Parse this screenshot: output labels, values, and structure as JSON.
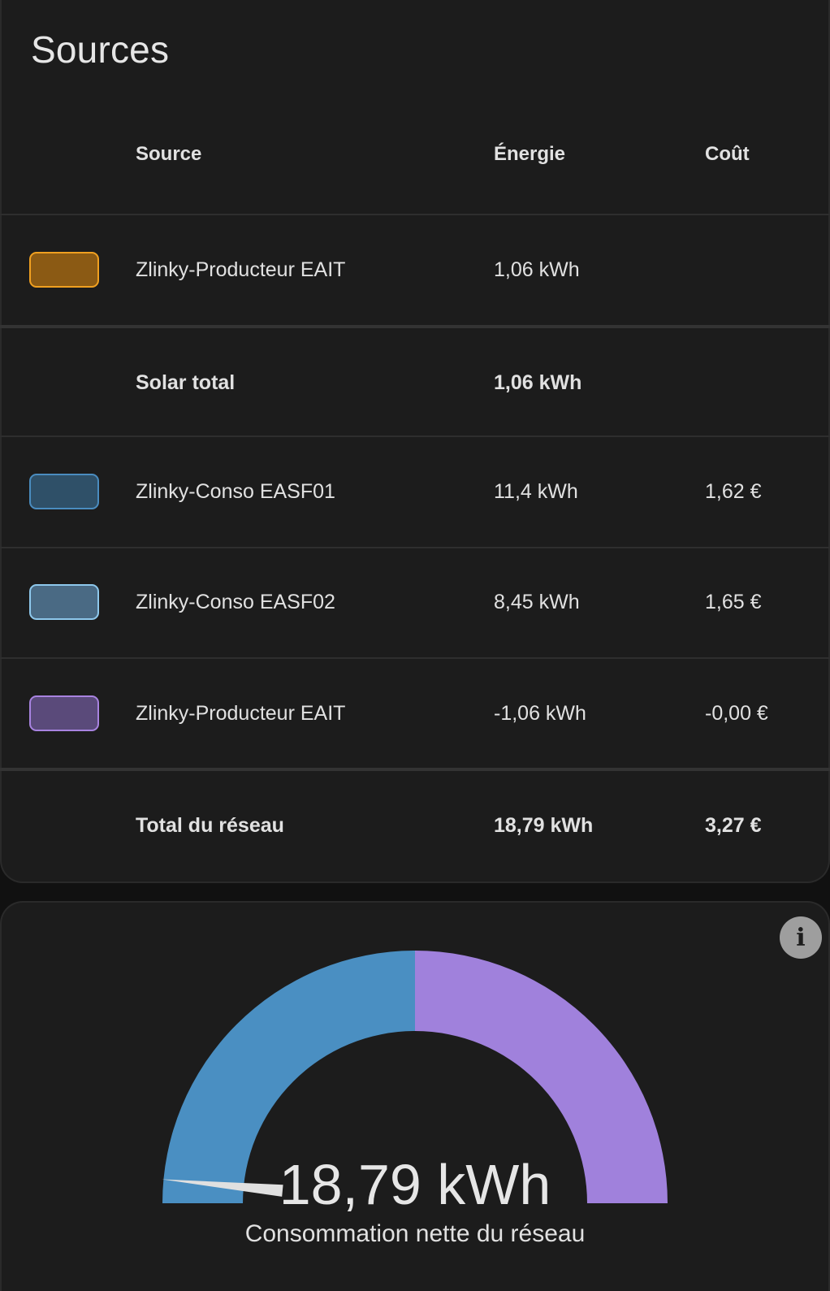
{
  "sources": {
    "title": "Sources",
    "columns": {
      "source": "Source",
      "energy": "Énergie",
      "cost": "Coût"
    },
    "rows": [
      {
        "name": "Zlinky-Producteur EAIT",
        "energy": "1,06 kWh",
        "cost": "",
        "fill": "#8b5a14",
        "border": "#f0a020"
      },
      {
        "name": "Solar total",
        "energy": "1,06 kWh",
        "cost": ""
      },
      {
        "name": "Zlinky-Conso EASF01",
        "energy": "11,4 kWh",
        "cost": "1,62 €",
        "fill": "#2f5068",
        "border": "#4a8cbf"
      },
      {
        "name": "Zlinky-Conso EASF02",
        "energy": "8,45 kWh",
        "cost": "1,65 €",
        "fill": "#4a6a84",
        "border": "#8ec8ec"
      },
      {
        "name": "Zlinky-Producteur EAIT",
        "energy": "-1,06 kWh",
        "cost": "-0,00 €",
        "fill": "#5a4a7a",
        "border": "#a883e0"
      },
      {
        "name": "Total du réseau",
        "energy": "18,79 kWh",
        "cost": "3,27 €"
      }
    ]
  },
  "gauge": {
    "info_icon": "info-icon",
    "value_text": "18,79 kWh",
    "label": "Consommation nette du réseau",
    "consumption_fraction": 0.5,
    "needle_fraction": 0.03,
    "colors": {
      "consumption": "#4a8fc2",
      "return": "#a081dc",
      "needle": "#e0e0e0"
    }
  }
}
